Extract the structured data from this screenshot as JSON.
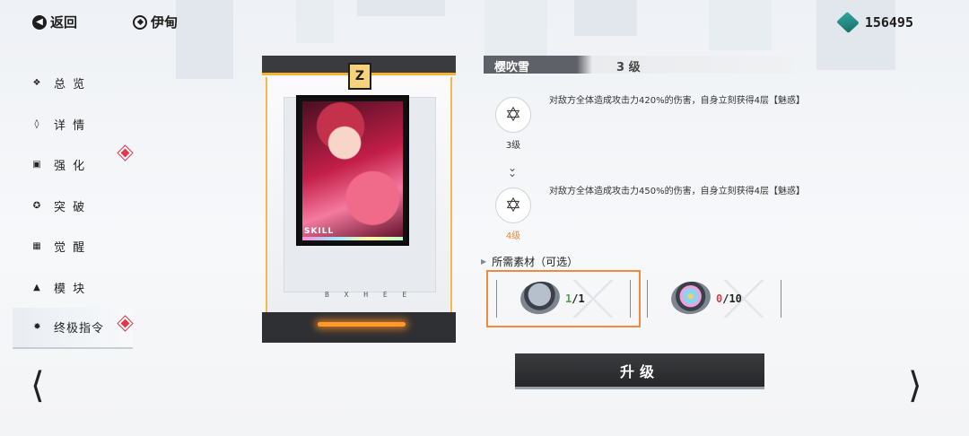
{
  "topbar": {
    "back_label": "返回",
    "character_name": "伊甸",
    "currency_amount": "156495",
    "currency_icon": "gem-icon"
  },
  "sidebar": {
    "items": [
      {
        "label": "总 览",
        "icon": "overview-icon",
        "badge": false,
        "active": false
      },
      {
        "label": "详 情",
        "icon": "details-icon",
        "badge": false,
        "active": false
      },
      {
        "label": "强 化",
        "icon": "enhance-icon",
        "badge": true,
        "active": false
      },
      {
        "label": "突 破",
        "icon": "breakthrough-icon",
        "badge": false,
        "active": false
      },
      {
        "label": "觉 醒",
        "icon": "awaken-icon",
        "badge": false,
        "active": false
      },
      {
        "label": "模 块",
        "icon": "module-icon",
        "badge": false,
        "active": false
      },
      {
        "label": "终极指令",
        "icon": "ultimate-icon",
        "badge": true,
        "active": true
      }
    ]
  },
  "card": {
    "emblem": "Z",
    "art_label": "SKILL",
    "code": "B X H E E"
  },
  "skill": {
    "name": "樱吹雪",
    "current_level": "3 级",
    "levels": [
      {
        "caption": "3级",
        "description": "对敌方全体造成攻击力420%的伤害，自身立刻获得4层【魅惑】",
        "caption_color": "#333333"
      },
      {
        "caption": "4级",
        "description": "对敌方全体造成攻击力450%的伤害，自身立刻获得4层【魅惑】",
        "caption_color": "#e8883a"
      }
    ]
  },
  "materials": {
    "title": "所需素材（可选）",
    "items": [
      {
        "have": "1",
        "need": "/1",
        "sufficient": true,
        "selected": true
      },
      {
        "have": "0",
        "need": "/10",
        "sufficient": false,
        "selected": false
      }
    ]
  },
  "upgrade_button": {
    "label": "升级"
  },
  "colors": {
    "accent_orange": "#f08a3c",
    "badge_red": "#e2384a",
    "dark_panel": "#2f3033"
  }
}
